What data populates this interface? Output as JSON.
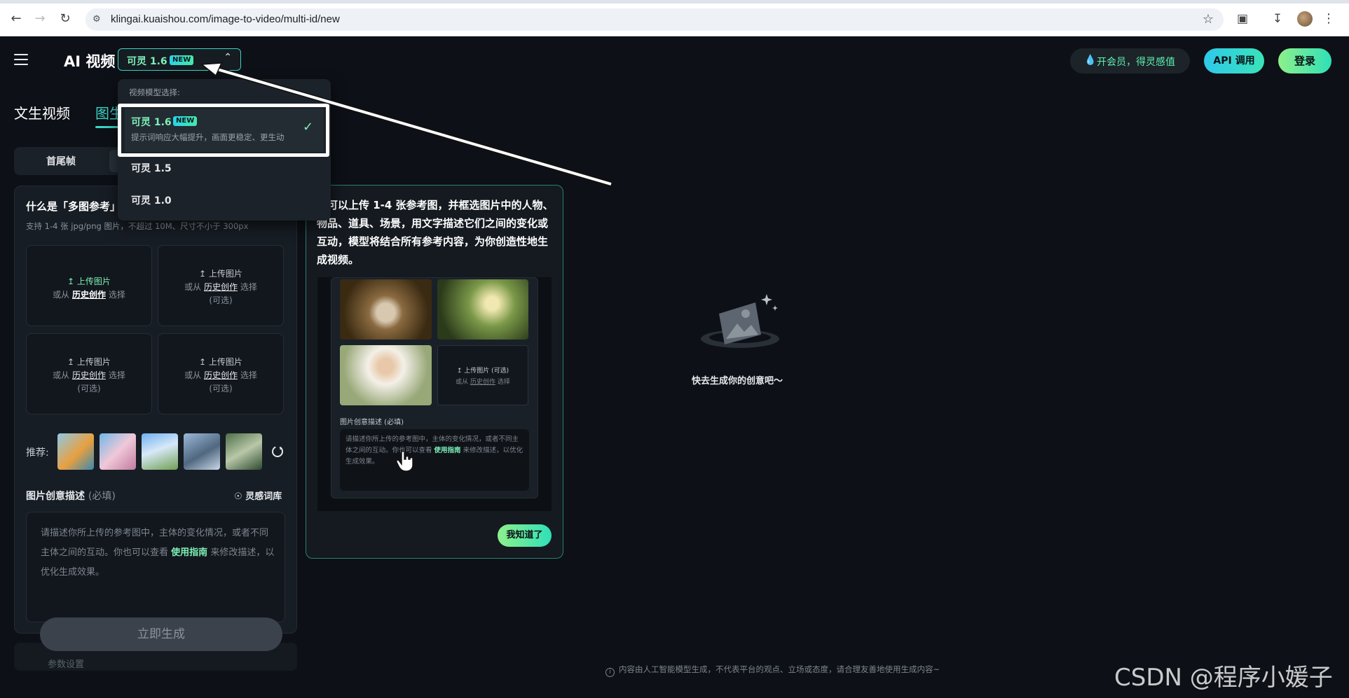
{
  "browser": {
    "url": "klingai.kuaishou.com/image-to-video/multi-id/new"
  },
  "header": {
    "title": "AI 视频",
    "model_selected": "可灵 1.6",
    "new_badge": "NEW",
    "vip_label": "开会员，得灵感值",
    "api_label": "API 调用",
    "login_label": "登录"
  },
  "tabs": {
    "text_to_video": "文生视频",
    "image_to_video": "图生视频"
  },
  "subtabs": {
    "first_last_frame": "首尾帧"
  },
  "dropdown": {
    "heading": "视频模型选择:",
    "options": [
      {
        "name": "可灵 1.6",
        "badge": "NEW",
        "desc": "提示词响应大幅提升，画面更稳定、更生动"
      },
      {
        "name": "可灵 1.5"
      },
      {
        "name": "可灵 1.0"
      }
    ]
  },
  "multi_ref": {
    "title": "什么是「多图参考」",
    "hint": "支持 1-4 张 jpg/png 图片，不超过 10M、尺寸不小于 300px",
    "upload_label": "上传图片",
    "or_from": "或从",
    "history": "历史创作",
    "select": "选择",
    "optional": "(可选)"
  },
  "recommend": {
    "label": "推荐:"
  },
  "description": {
    "label": "图片创意描述",
    "required": "(必填)",
    "inspire": "灵感词库",
    "placeholder_a": "请描述你所上传的参考图中，主体的变化情况，或者不同主体之间的互动。你也可以查看",
    "guide": "使用指南",
    "placeholder_b": "来修改描述，以优化生成效果。"
  },
  "generate": {
    "label": "立即生成",
    "params": "参数设置"
  },
  "tutorial": {
    "text": "你可以上传 1-4 张参考图，并框选图片中的人物、物品、道具、场景，用文字描述它们之间的变化或互动，模型将结合所有参考内容，为你创造性地生成视频。",
    "upload_optional": "上传图片 (可选)",
    "or_history": "或从",
    "history": "历史创作",
    "select": "选择",
    "desc_label": "图片创意描述 (必填)",
    "desc_a": "请描述你所上传的参考图中，主体的变化情况，或者不同主体之间的互动。你也可以查看",
    "desc_guide": "使用指南",
    "desc_b": "来修改描述，以优化生成效果。",
    "got_it": "我知道了"
  },
  "empty_state": {
    "text": "快去生成你的创意吧～"
  },
  "footer": {
    "note": "内容由人工智能模型生成，不代表平台的观点、立场或态度，请合理友善地使用生成内容~"
  },
  "watermark": "CSDN @程序小媛子"
}
